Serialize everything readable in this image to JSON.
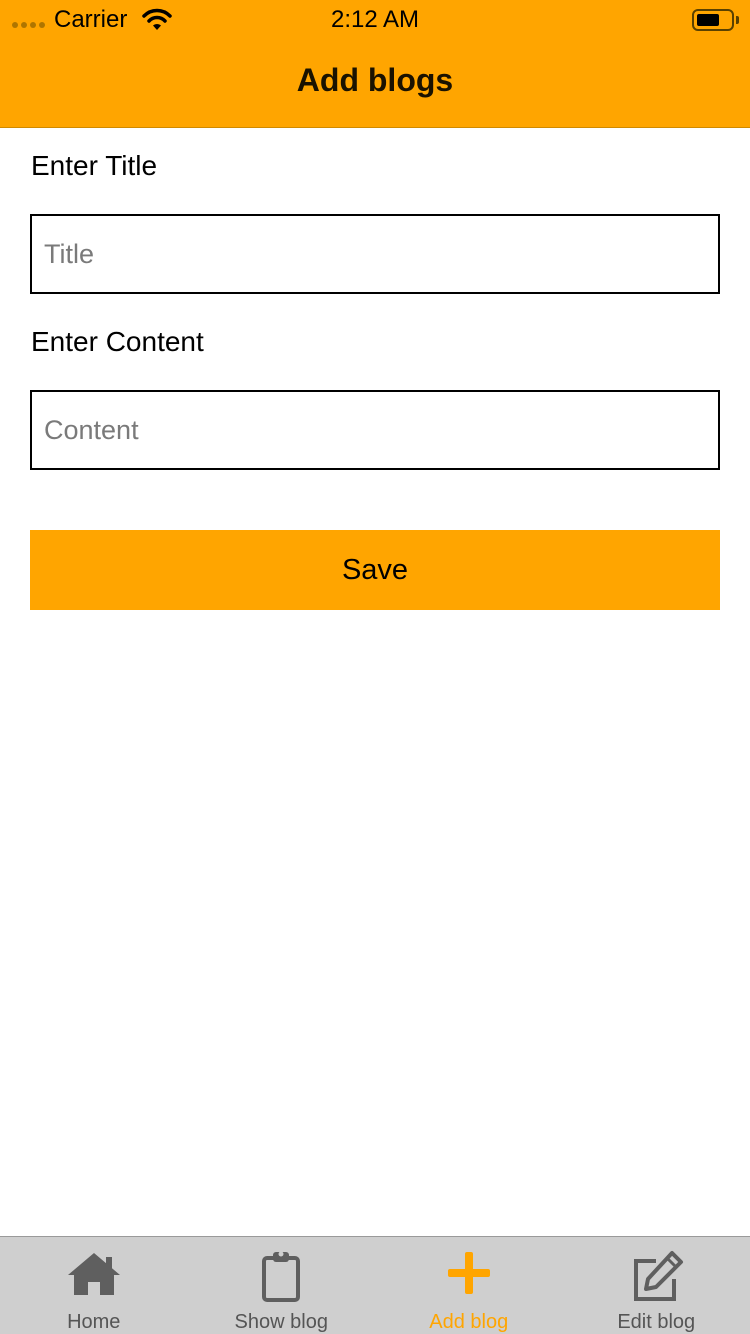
{
  "status_bar": {
    "carrier": "Carrier",
    "time": "2:12 AM"
  },
  "header": {
    "title": "Add blogs"
  },
  "form": {
    "title_label": "Enter Title",
    "title_placeholder": "Title",
    "title_value": "",
    "content_label": "Enter Content",
    "content_placeholder": "Content",
    "content_value": "",
    "save_label": "Save"
  },
  "tabs": [
    {
      "label": "Home",
      "icon": "home-icon",
      "active": false
    },
    {
      "label": "Show blog",
      "icon": "clipboard-icon",
      "active": false
    },
    {
      "label": "Add blog",
      "icon": "plus-icon",
      "active": true
    },
    {
      "label": "Edit blog",
      "icon": "edit-icon",
      "active": false
    }
  ],
  "colors": {
    "accent": "#FFA500",
    "tab_bar": "#CFCFCF",
    "tab_inactive": "#555555"
  }
}
